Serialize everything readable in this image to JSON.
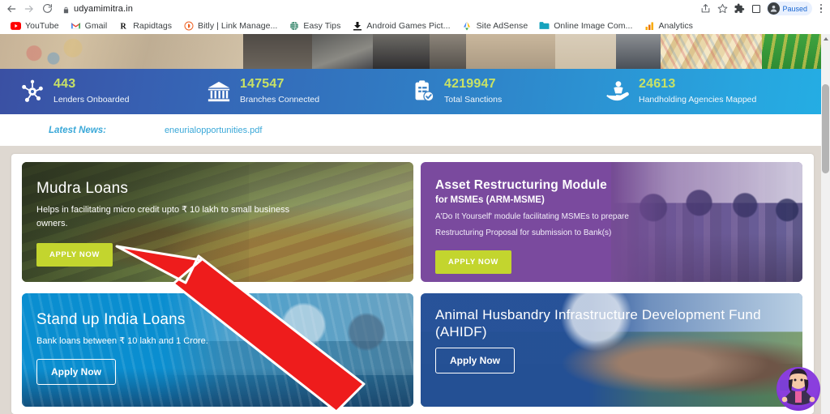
{
  "browser": {
    "url": "udyamimitra.in",
    "nav": {
      "back": "back-arrow",
      "forward": "forward-arrow",
      "reload": "reload"
    },
    "toolbar_icons": [
      "share-icon",
      "star-icon",
      "extensions-icon",
      "sidepanel-icon"
    ],
    "profile": {
      "label": "Paused"
    },
    "menu": "kebab-menu",
    "bookmarks": [
      {
        "label": "YouTube",
        "icon": "youtube-icon"
      },
      {
        "label": "Gmail",
        "icon": "gmail-icon"
      },
      {
        "label": "Rapidtags",
        "icon": "rapidtags-icon"
      },
      {
        "label": "Bitly | Link Manage...",
        "icon": "bitly-icon"
      },
      {
        "label": "Easy Tips",
        "icon": "globe-icon"
      },
      {
        "label": "Android Games Pict...",
        "icon": "download-icon"
      },
      {
        "label": "Site AdSense",
        "icon": "adsense-icon"
      },
      {
        "label": "Online Image Com...",
        "icon": "folder-icon"
      },
      {
        "label": "Analytics",
        "icon": "analytics-icon"
      }
    ]
  },
  "stats": [
    {
      "icon": "network-node-icon",
      "value": "443",
      "label": "Lenders Onboarded"
    },
    {
      "icon": "bank-icon",
      "value": "147547",
      "label": "Branches Connected"
    },
    {
      "icon": "clipboard-check-icon",
      "value": "4219947",
      "label": "Total Sanctions"
    },
    {
      "icon": "handholding-icon",
      "value": "24613",
      "label": "Handholding Agencies Mapped"
    }
  ],
  "news": {
    "label": "Latest News:",
    "item": "eneurialopportunities.pdf"
  },
  "cards": {
    "mudra": {
      "title": "Mudra Loans",
      "desc": "Helps in facilitating micro credit upto ₹ 10 lakh to small business owners.",
      "button": "APPLY NOW"
    },
    "arm": {
      "title": "Asset Restructuring Module",
      "subtitle": "for MSMEs (ARM-MSME)",
      "line1": "A'Do It Yourself' module facilitating MSMEs to prepare",
      "line2": "Restructuring Proposal for submission to Bank(s)",
      "button": "APPLY NOW"
    },
    "standup": {
      "title": "Stand up India Loans",
      "desc": "Bank loans between ₹ 10 lakh and 1 Crore.",
      "button": "Apply Now"
    },
    "ahidf": {
      "title": "Animal Husbandry Infrastructure Development Fund (AHIDF)",
      "button": "Apply Now"
    }
  },
  "overlay": {
    "arrow": "red-arrow-pointer",
    "arrow_color": "#ee1c1c"
  },
  "chatbot": {
    "name": "chatbot-avatar"
  },
  "colors": {
    "stat_number": "#c9e265",
    "lime_button": "#c3d52e",
    "purple_card": "#7a4a9e",
    "cyan_card": "#1aa3dd",
    "blue_card": "#2b5ea8",
    "page_background": "#ded8d1",
    "news_text": "#3aa8d8"
  }
}
